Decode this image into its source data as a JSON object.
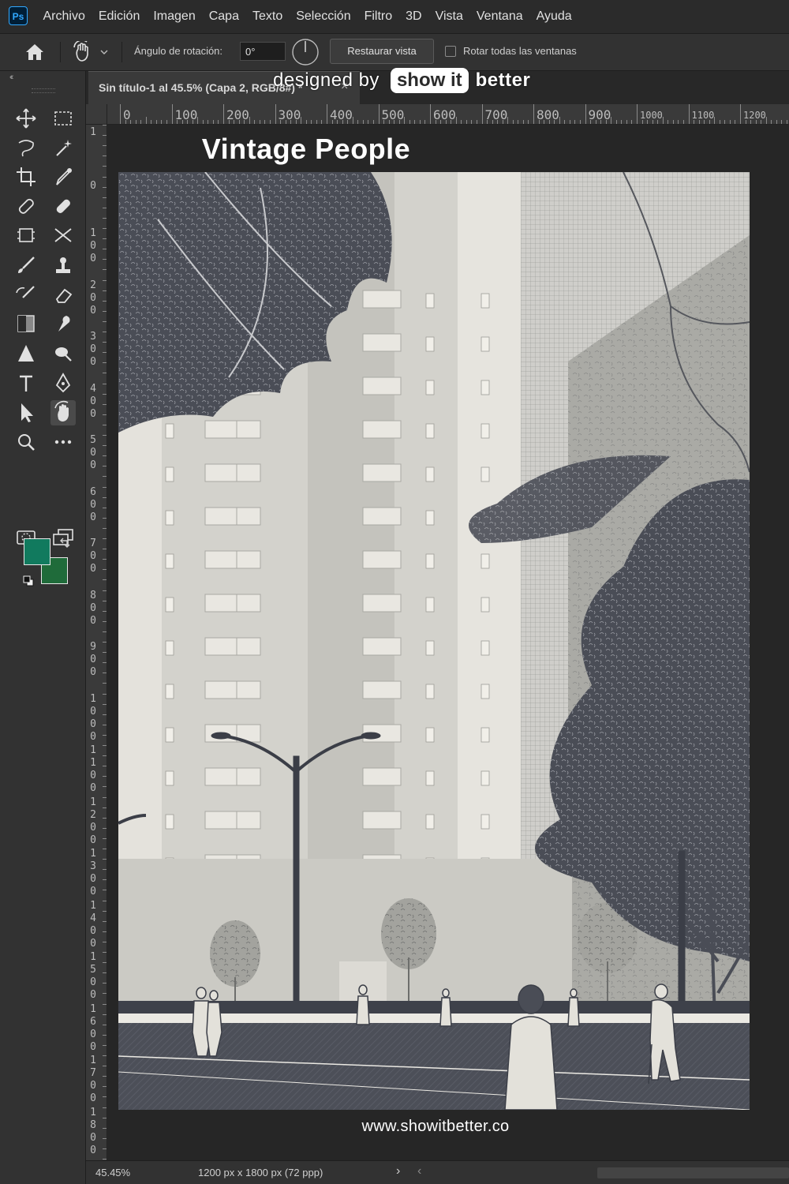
{
  "app": {
    "logo": "Ps"
  },
  "menu": [
    "Archivo",
    "Edición",
    "Imagen",
    "Capa",
    "Texto",
    "Selección",
    "Filtro",
    "3D",
    "Vista",
    "Ventana",
    "Ayuda"
  ],
  "options": {
    "rotation_label": "Ángulo de rotación:",
    "rotation_value": "0°",
    "reset_label": "Restaurar vista",
    "rotate_all_label": "Rotar todas las ventanas",
    "rotate_all_checked": false
  },
  "toolbar": {
    "collapse_glyph": "‹‹",
    "tools": [
      "move-tool-icon",
      "marquee-tool-icon",
      "lasso-tool-icon",
      "magic-wand-tool-icon",
      "crop-tool-icon",
      "eyedropper-tool-icon",
      "spot-healing-tool-icon",
      "bandage-tool-icon",
      "frame-tool-icon",
      "content-aware-move-tool-icon",
      "brush-tool-icon",
      "clone-stamp-tool-icon",
      "history-brush-tool-icon",
      "eraser-tool-icon",
      "gradient-tool-icon",
      "smudge-tool-icon",
      "sharpen-tool-icon",
      "dodge-tool-icon",
      "type-tool-icon",
      "pen-tool-icon",
      "path-selection-tool-icon",
      "rotate-view-tool-icon",
      "zoom-tool-icon",
      "more-tools-icon",
      "quick-mask-icon",
      "screen-mode-icon"
    ],
    "active_tool": "rotate-view-tool-icon",
    "foreground_color": "#117a5e",
    "background_color": "#1f6b3a"
  },
  "document": {
    "tab_title": "Sin título-1 al 45.5% (Capa 2, RGB/8#) *",
    "close_glyph": "×"
  },
  "watermark": {
    "prefix": "designed by",
    "pill": "show it",
    "suffix": "better"
  },
  "ruler": {
    "horizontal": [
      "0",
      "100",
      "200",
      "300",
      "400",
      "500",
      "600",
      "700",
      "800",
      "900",
      "1000",
      "1100",
      "1200"
    ],
    "vertical": [
      "1",
      "0",
      "100",
      "200",
      "300",
      "400",
      "500",
      "600",
      "700",
      "800",
      "900",
      "1000",
      "1100",
      "1200",
      "1300",
      "1400",
      "1500",
      "1600",
      "1700",
      "1800"
    ]
  },
  "poster": {
    "title": "Vintage People",
    "url": "www.showitbetter.co"
  },
  "status": {
    "zoom": "45.45%",
    "size": "1200 px x 1800 px (72 ppp)",
    "next_glyph": "›",
    "prev_glyph": "‹"
  }
}
